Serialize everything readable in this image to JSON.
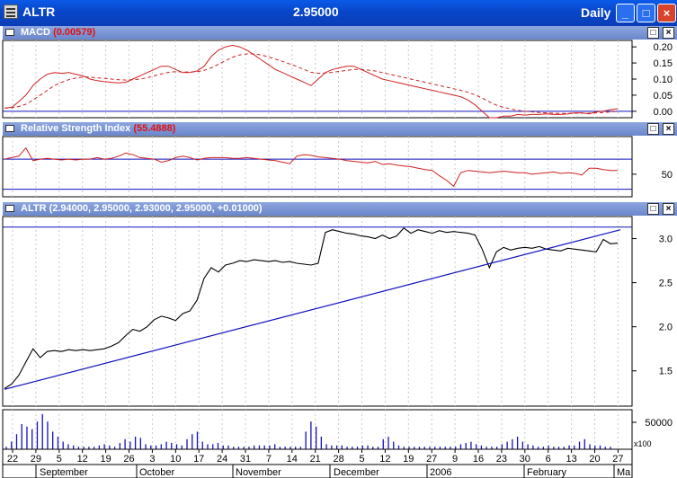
{
  "window": {
    "title": "ALTR",
    "price": "2.95000",
    "period": "Daily",
    "icon": "app-icon"
  },
  "panes": {
    "macd": {
      "name": "MACD",
      "value": "(0.00579)"
    },
    "rsi": {
      "name": "Relative Strength Index",
      "value": "(55.4888)"
    },
    "price": {
      "name": "ALTR",
      "value": "(2.94000, 2.95000, 2.93000, 2.95000, +0.01000)"
    }
  },
  "chart_data": [
    {
      "type": "line",
      "name": "MACD",
      "y_ticks": [
        "0.20",
        "0.15",
        "0.10",
        "0.05",
        "0.00"
      ],
      "ylim": [
        -0.02,
        0.22
      ],
      "series": [
        {
          "name": "MACD",
          "color": "#d02020",
          "style": "solid",
          "values": [
            0.01,
            0.012,
            0.03,
            0.05,
            0.08,
            0.1,
            0.115,
            0.12,
            0.118,
            0.12,
            0.115,
            0.11,
            0.1,
            0.095,
            0.092,
            0.09,
            0.088,
            0.09,
            0.1,
            0.11,
            0.12,
            0.13,
            0.14,
            0.14,
            0.13,
            0.12,
            0.12,
            0.125,
            0.14,
            0.17,
            0.19,
            0.2,
            0.205,
            0.2,
            0.19,
            0.175,
            0.16,
            0.145,
            0.13,
            0.12,
            0.11,
            0.1,
            0.09,
            0.08,
            0.1,
            0.12,
            0.13,
            0.135,
            0.14,
            0.14,
            0.13,
            0.12,
            0.11,
            0.1,
            0.095,
            0.09,
            0.085,
            0.08,
            0.075,
            0.07,
            0.065,
            0.06,
            0.055,
            0.05,
            0.045,
            0.035,
            0.02,
            0.0,
            -0.02,
            -0.02,
            -0.015,
            -0.015,
            -0.01,
            -0.012,
            -0.01,
            -0.01,
            -0.008,
            -0.01,
            -0.01,
            -0.008,
            -0.005,
            -0.005,
            -0.008,
            -0.002,
            0.0,
            0.005,
            0.008
          ]
        },
        {
          "name": "Signal",
          "color": "#d02020",
          "style": "dashed",
          "values": [
            0.01,
            0.011,
            0.015,
            0.022,
            0.035,
            0.05,
            0.065,
            0.08,
            0.09,
            0.098,
            0.103,
            0.106,
            0.106,
            0.104,
            0.102,
            0.1,
            0.098,
            0.097,
            0.098,
            0.1,
            0.104,
            0.11,
            0.116,
            0.121,
            0.123,
            0.122,
            0.122,
            0.123,
            0.127,
            0.135,
            0.146,
            0.157,
            0.168,
            0.175,
            0.178,
            0.178,
            0.175,
            0.169,
            0.162,
            0.155,
            0.147,
            0.139,
            0.13,
            0.121,
            0.118,
            0.119,
            0.121,
            0.124,
            0.127,
            0.13,
            0.13,
            0.128,
            0.125,
            0.12,
            0.115,
            0.11,
            0.105,
            0.1,
            0.095,
            0.09,
            0.085,
            0.08,
            0.075,
            0.07,
            0.065,
            0.059,
            0.051,
            0.041,
            0.029,
            0.019,
            0.012,
            0.007,
            0.003,
            0.0,
            -0.002,
            -0.004,
            -0.005,
            -0.006,
            -0.007,
            -0.007,
            -0.006,
            -0.006,
            -0.006,
            -0.005,
            -0.004,
            -0.002,
            0.0
          ]
        }
      ]
    },
    {
      "type": "line",
      "name": "Relative Strength Index",
      "y_ticks": [
        "50"
      ],
      "ylim": [
        20,
        100
      ],
      "series": [
        {
          "name": "RSI",
          "color": "#d02020",
          "values": [
            70,
            72,
            74,
            85,
            68,
            70,
            71,
            70,
            69,
            70,
            69,
            70,
            70,
            72,
            70,
            71,
            74,
            78,
            76,
            72,
            71,
            70,
            66,
            68,
            72,
            74,
            72,
            69,
            71,
            72,
            72,
            72,
            71,
            71,
            72,
            71,
            70,
            69,
            68,
            66,
            64,
            74,
            76,
            75,
            73,
            72,
            71,
            70,
            68,
            67,
            66,
            65,
            67,
            63,
            64,
            62,
            61,
            60,
            58,
            56,
            55,
            48,
            42,
            34,
            52,
            55,
            54,
            53,
            52,
            53,
            54,
            53,
            52,
            52,
            50,
            51,
            52,
            53,
            51,
            52,
            51,
            49,
            58,
            58,
            56,
            55,
            55
          ]
        }
      ],
      "reference_lines": [
        70,
        30
      ]
    },
    {
      "type": "line",
      "name": "ALTR",
      "y_ticks": [
        "3.0",
        "2.5",
        "2.0",
        "1.5"
      ],
      "ylim": [
        1.1,
        3.25
      ],
      "series": [
        {
          "name": "ALTR",
          "color": "#000000",
          "values": [
            1.3,
            1.35,
            1.45,
            1.6,
            1.75,
            1.65,
            1.72,
            1.73,
            1.72,
            1.74,
            1.73,
            1.74,
            1.73,
            1.74,
            1.75,
            1.78,
            1.82,
            1.9,
            1.97,
            1.95,
            2.0,
            2.08,
            2.12,
            2.1,
            2.07,
            2.15,
            2.18,
            2.3,
            2.55,
            2.67,
            2.62,
            2.7,
            2.72,
            2.75,
            2.74,
            2.76,
            2.75,
            2.74,
            2.75,
            2.73,
            2.74,
            2.72,
            2.71,
            2.7,
            2.72,
            3.07,
            3.1,
            3.08,
            3.06,
            3.05,
            3.03,
            3.02,
            3.0,
            3.04,
            3.0,
            3.03,
            3.12,
            3.06,
            3.1,
            3.08,
            3.06,
            3.09,
            3.07,
            3.08,
            3.07,
            3.06,
            3.04,
            2.88,
            2.67,
            2.85,
            2.9,
            2.87,
            2.89,
            2.9,
            2.89,
            2.91,
            2.88,
            2.87,
            2.86,
            2.89,
            2.88,
            2.87,
            2.86,
            2.85,
            2.99,
            2.94,
            2.95
          ]
        },
        {
          "name": "Trendline",
          "color": "#1010c0",
          "values": [
            1.29,
            3.1
          ]
        }
      ],
      "reference_lines": [
        3.13
      ]
    },
    {
      "type": "bar",
      "name": "Volume",
      "y_ticks": [
        "50000"
      ],
      "scale_label": "x100",
      "values": [
        2,
        6,
        12,
        20,
        18,
        16,
        22,
        28,
        22,
        14,
        10,
        6,
        4,
        3,
        2,
        2,
        2,
        2,
        3,
        4,
        3,
        2,
        5,
        8,
        6,
        10,
        9,
        4,
        3,
        3,
        4,
        6,
        5,
        4,
        3,
        8,
        12,
        14,
        6,
        4,
        4,
        5,
        3,
        3,
        2,
        2,
        2,
        2,
        3,
        3,
        3,
        3,
        4,
        2,
        2,
        2,
        2,
        2,
        14,
        22,
        18,
        10,
        4,
        3,
        3,
        3,
        2,
        2,
        2,
        3,
        3,
        2,
        2,
        8,
        10,
        6,
        3,
        2,
        2,
        2,
        2,
        2,
        2,
        2,
        2,
        2,
        2,
        2,
        4,
        5,
        6,
        4,
        3,
        2,
        2,
        2,
        4,
        6,
        8,
        10,
        6,
        4,
        3,
        2,
        2,
        3,
        2,
        2,
        2,
        3,
        3,
        6,
        8,
        4,
        3,
        3,
        2,
        2
      ]
    }
  ],
  "x_axis": {
    "day_ticks": [
      "22",
      "29",
      "5",
      "12",
      "19",
      "26",
      "3",
      "10",
      "17",
      "24",
      "31",
      "7",
      "14",
      "21",
      "28",
      "5",
      "12",
      "19",
      "27",
      "9",
      "16",
      "23",
      "30",
      "6",
      "13",
      "20",
      "27"
    ],
    "months": [
      "September",
      "October",
      "November",
      "December",
      "2006",
      "February",
      "Ma"
    ]
  }
}
